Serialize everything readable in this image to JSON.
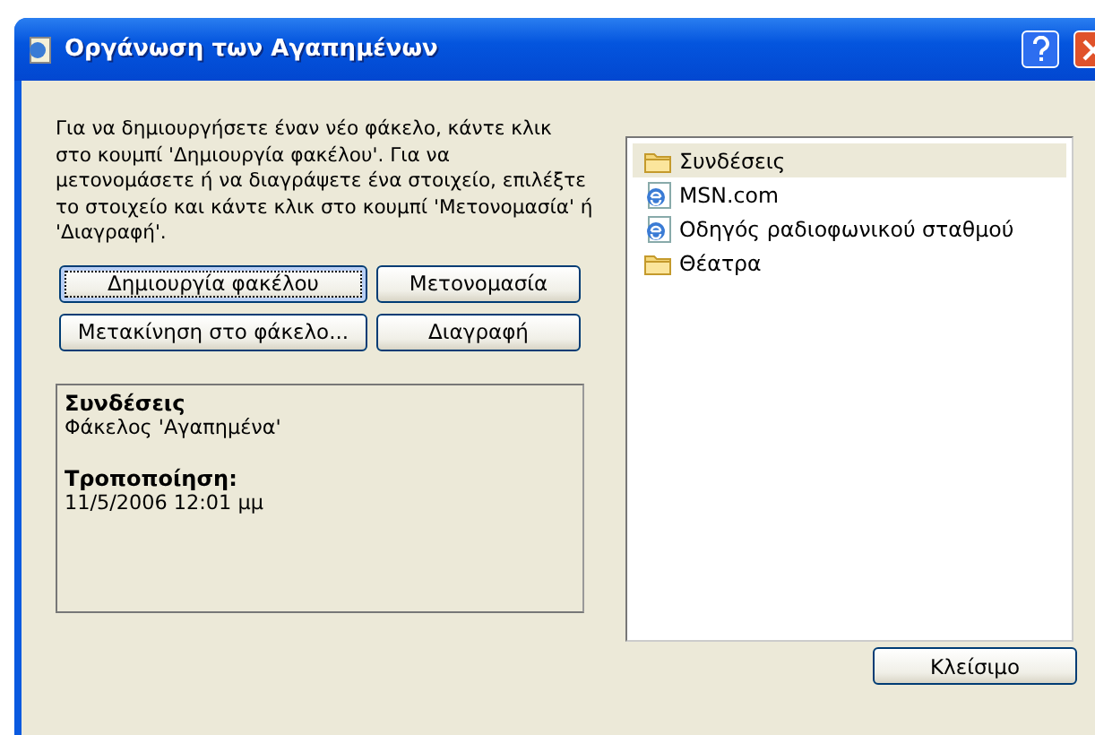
{
  "window": {
    "title": "Οργάνωση των Αγαπημένων"
  },
  "instructions": "Για να δημιουργήσετε έναν νέο φάκελο, κάντε κλικ στο κουμπί 'Δημιουργία φακέλου'. Για να μετονομάσετε ή να διαγράψετε ένα στοιχείο, επιλέξτε το στοιχείο και κάντε κλικ στο κουμπί 'Μετονομασία' ή 'Διαγραφή'.",
  "buttons": [
    {
      "label": "Δημιουργία φακέλου",
      "focused": true
    },
    {
      "label": "Μετονομασία",
      "focused": false
    },
    {
      "label": "Μετακίνηση στο φάκελο...",
      "focused": false
    },
    {
      "label": "Διαγραφή",
      "focused": false
    }
  ],
  "info": {
    "name": "Συνδέσεις",
    "type": "Φάκελος 'Αγαπημένα'",
    "modified_label": "Τροποποίηση:",
    "modified_value": "11/5/2006 12:01 μμ"
  },
  "favorites": [
    {
      "kind": "folder",
      "label": "Συνδέσεις",
      "selected": true
    },
    {
      "kind": "link",
      "label": "MSN.com",
      "selected": false
    },
    {
      "kind": "link",
      "label": "Οδηγός ραδιοφωνικού σταθμού",
      "selected": false
    },
    {
      "kind": "folder",
      "label": "Θέατρα",
      "selected": false
    }
  ],
  "close_button": "Κλείσιμο"
}
